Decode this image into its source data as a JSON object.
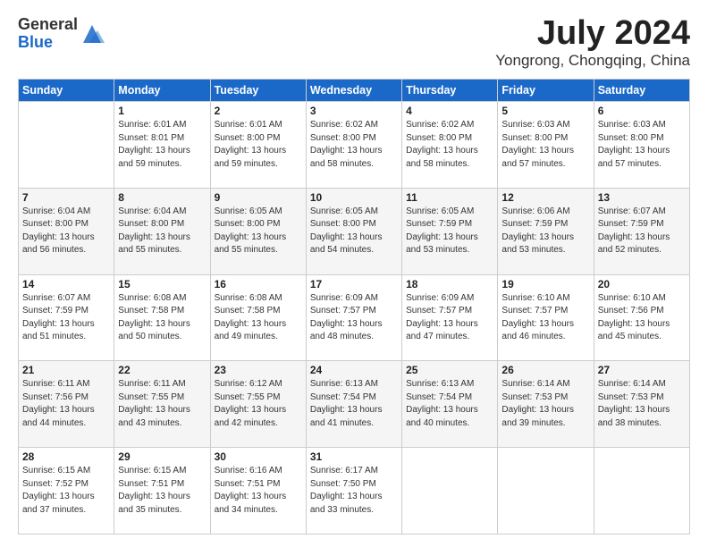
{
  "header": {
    "logo_general": "General",
    "logo_blue": "Blue",
    "month_title": "July 2024",
    "location": "Yongrong, Chongqing, China"
  },
  "weekdays": [
    "Sunday",
    "Monday",
    "Tuesday",
    "Wednesday",
    "Thursday",
    "Friday",
    "Saturday"
  ],
  "weeks": [
    [
      {
        "day": "",
        "info": ""
      },
      {
        "day": "1",
        "info": "Sunrise: 6:01 AM\nSunset: 8:01 PM\nDaylight: 13 hours\nand 59 minutes."
      },
      {
        "day": "2",
        "info": "Sunrise: 6:01 AM\nSunset: 8:00 PM\nDaylight: 13 hours\nand 59 minutes."
      },
      {
        "day": "3",
        "info": "Sunrise: 6:02 AM\nSunset: 8:00 PM\nDaylight: 13 hours\nand 58 minutes."
      },
      {
        "day": "4",
        "info": "Sunrise: 6:02 AM\nSunset: 8:00 PM\nDaylight: 13 hours\nand 58 minutes."
      },
      {
        "day": "5",
        "info": "Sunrise: 6:03 AM\nSunset: 8:00 PM\nDaylight: 13 hours\nand 57 minutes."
      },
      {
        "day": "6",
        "info": "Sunrise: 6:03 AM\nSunset: 8:00 PM\nDaylight: 13 hours\nand 57 minutes."
      }
    ],
    [
      {
        "day": "7",
        "info": "Sunrise: 6:04 AM\nSunset: 8:00 PM\nDaylight: 13 hours\nand 56 minutes."
      },
      {
        "day": "8",
        "info": "Sunrise: 6:04 AM\nSunset: 8:00 PM\nDaylight: 13 hours\nand 55 minutes."
      },
      {
        "day": "9",
        "info": "Sunrise: 6:05 AM\nSunset: 8:00 PM\nDaylight: 13 hours\nand 55 minutes."
      },
      {
        "day": "10",
        "info": "Sunrise: 6:05 AM\nSunset: 8:00 PM\nDaylight: 13 hours\nand 54 minutes."
      },
      {
        "day": "11",
        "info": "Sunrise: 6:05 AM\nSunset: 7:59 PM\nDaylight: 13 hours\nand 53 minutes."
      },
      {
        "day": "12",
        "info": "Sunrise: 6:06 AM\nSunset: 7:59 PM\nDaylight: 13 hours\nand 53 minutes."
      },
      {
        "day": "13",
        "info": "Sunrise: 6:07 AM\nSunset: 7:59 PM\nDaylight: 13 hours\nand 52 minutes."
      }
    ],
    [
      {
        "day": "14",
        "info": "Sunrise: 6:07 AM\nSunset: 7:59 PM\nDaylight: 13 hours\nand 51 minutes."
      },
      {
        "day": "15",
        "info": "Sunrise: 6:08 AM\nSunset: 7:58 PM\nDaylight: 13 hours\nand 50 minutes."
      },
      {
        "day": "16",
        "info": "Sunrise: 6:08 AM\nSunset: 7:58 PM\nDaylight: 13 hours\nand 49 minutes."
      },
      {
        "day": "17",
        "info": "Sunrise: 6:09 AM\nSunset: 7:57 PM\nDaylight: 13 hours\nand 48 minutes."
      },
      {
        "day": "18",
        "info": "Sunrise: 6:09 AM\nSunset: 7:57 PM\nDaylight: 13 hours\nand 47 minutes."
      },
      {
        "day": "19",
        "info": "Sunrise: 6:10 AM\nSunset: 7:57 PM\nDaylight: 13 hours\nand 46 minutes."
      },
      {
        "day": "20",
        "info": "Sunrise: 6:10 AM\nSunset: 7:56 PM\nDaylight: 13 hours\nand 45 minutes."
      }
    ],
    [
      {
        "day": "21",
        "info": "Sunrise: 6:11 AM\nSunset: 7:56 PM\nDaylight: 13 hours\nand 44 minutes."
      },
      {
        "day": "22",
        "info": "Sunrise: 6:11 AM\nSunset: 7:55 PM\nDaylight: 13 hours\nand 43 minutes."
      },
      {
        "day": "23",
        "info": "Sunrise: 6:12 AM\nSunset: 7:55 PM\nDaylight: 13 hours\nand 42 minutes."
      },
      {
        "day": "24",
        "info": "Sunrise: 6:13 AM\nSunset: 7:54 PM\nDaylight: 13 hours\nand 41 minutes."
      },
      {
        "day": "25",
        "info": "Sunrise: 6:13 AM\nSunset: 7:54 PM\nDaylight: 13 hours\nand 40 minutes."
      },
      {
        "day": "26",
        "info": "Sunrise: 6:14 AM\nSunset: 7:53 PM\nDaylight: 13 hours\nand 39 minutes."
      },
      {
        "day": "27",
        "info": "Sunrise: 6:14 AM\nSunset: 7:53 PM\nDaylight: 13 hours\nand 38 minutes."
      }
    ],
    [
      {
        "day": "28",
        "info": "Sunrise: 6:15 AM\nSunset: 7:52 PM\nDaylight: 13 hours\nand 37 minutes."
      },
      {
        "day": "29",
        "info": "Sunrise: 6:15 AM\nSunset: 7:51 PM\nDaylight: 13 hours\nand 35 minutes."
      },
      {
        "day": "30",
        "info": "Sunrise: 6:16 AM\nSunset: 7:51 PM\nDaylight: 13 hours\nand 34 minutes."
      },
      {
        "day": "31",
        "info": "Sunrise: 6:17 AM\nSunset: 7:50 PM\nDaylight: 13 hours\nand 33 minutes."
      },
      {
        "day": "",
        "info": ""
      },
      {
        "day": "",
        "info": ""
      },
      {
        "day": "",
        "info": ""
      }
    ]
  ]
}
